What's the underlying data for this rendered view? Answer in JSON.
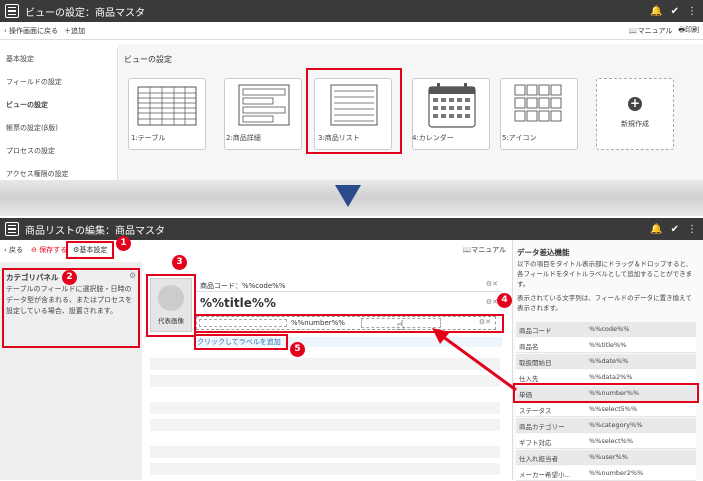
{
  "top": {
    "title": "ビューの設定：商品マスタ",
    "back": "操作画面に戻る",
    "add": "追加",
    "manual": "マニュアル",
    "print": "印刷",
    "sidebar": [
      "基本設定",
      "フィールドの設定",
      "ビューの設定",
      "帳票の設定(β版)",
      "プロセスの設定",
      "アクセス権限の設定"
    ],
    "section": "ビューの設定",
    "views": [
      "1:テーブル",
      "2:商品詳細",
      "3:商品リスト",
      "4:カレンダー",
      "5:アイコン"
    ],
    "new_view": "新規作成"
  },
  "bottom": {
    "title": "商品リストの編集：商品マスタ",
    "back": "戻る",
    "save": "保存する",
    "basic": "基本設定",
    "manual": "マニュアル",
    "category_title": "カテゴリパネル",
    "category_desc": "テーブルのフィールドに選択肢・日時のデータ型が含まれる、またはプロセスを設定している場合、設置されます。",
    "image": "代表画像",
    "code_field": "商品コード：%%code%%",
    "title_field": "%%title%%",
    "number_field": "%%number%%",
    "add_label": "クリックしてラベルを追加",
    "data_title": "データ差込機能",
    "data_desc1": "以下の項目をタイトル表示部にドラッグ＆ドロップすると、各フィールドをタイトルラベルとして追加することができます。",
    "data_desc2": "表示されている文字列は、フィールドのデータに置き換えて表示されます。",
    "fields": [
      {
        "k": "商品コード",
        "v": "%%code%%"
      },
      {
        "k": "商品名",
        "v": "%%title%%"
      },
      {
        "k": "取扱開始日",
        "v": "%%date%%"
      },
      {
        "k": "仕入先",
        "v": "%%data2%%"
      },
      {
        "k": "単価",
        "v": "%%number%%"
      },
      {
        "k": "ステータス",
        "v": "%%select5%%"
      },
      {
        "k": "商品カテゴリー",
        "v": "%%category%%"
      },
      {
        "k": "ギフト対応",
        "v": "%%select%%"
      },
      {
        "k": "仕入れ担当者",
        "v": "%%user%%"
      },
      {
        "k": "メーカー希望小...",
        "v": "%%number2%%"
      }
    ]
  },
  "badges": [
    "1",
    "2",
    "3",
    "4",
    "5"
  ],
  "colors": {
    "header": "#3a3a3a",
    "highlight": "#e4001b",
    "arrow": "#2b4a8c"
  }
}
